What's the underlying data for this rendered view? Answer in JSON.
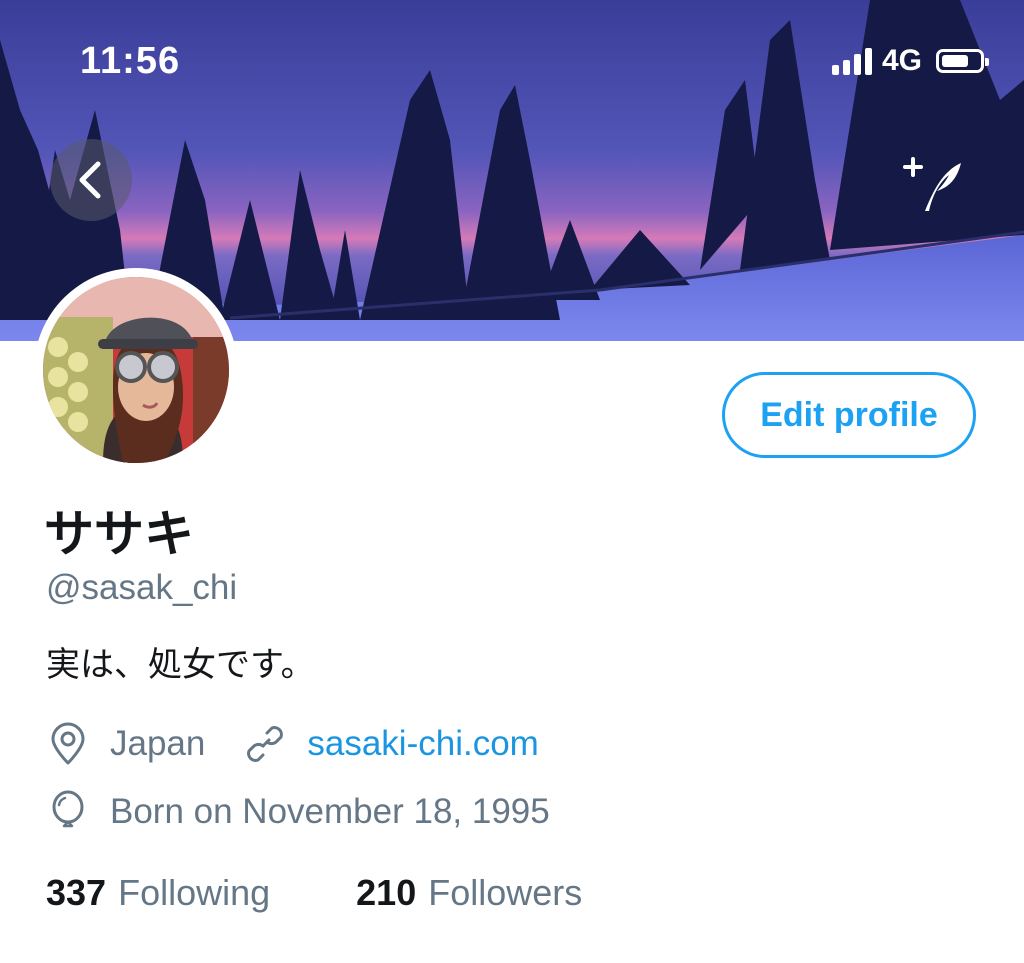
{
  "status_bar": {
    "time": "11:56",
    "network": "4G"
  },
  "profile": {
    "name": "ササキ",
    "handle": "@sasak_chi",
    "bio": "実は、処女です。",
    "location": "Japan",
    "website": "sasaki-chi.com",
    "birthday": "Born on November 18, 1995"
  },
  "actions": {
    "edit_profile_label": "Edit profile"
  },
  "stats": {
    "following_count": "337",
    "following_label": "Following",
    "followers_count": "210",
    "followers_label": "Followers"
  },
  "colors": {
    "accent": "#1da1f2",
    "link": "#1b95e0",
    "secondary_text": "#657786",
    "primary_text": "#14171a"
  },
  "icons": [
    "back-icon",
    "compose-icon",
    "location-icon",
    "link-icon",
    "balloon-icon"
  ]
}
